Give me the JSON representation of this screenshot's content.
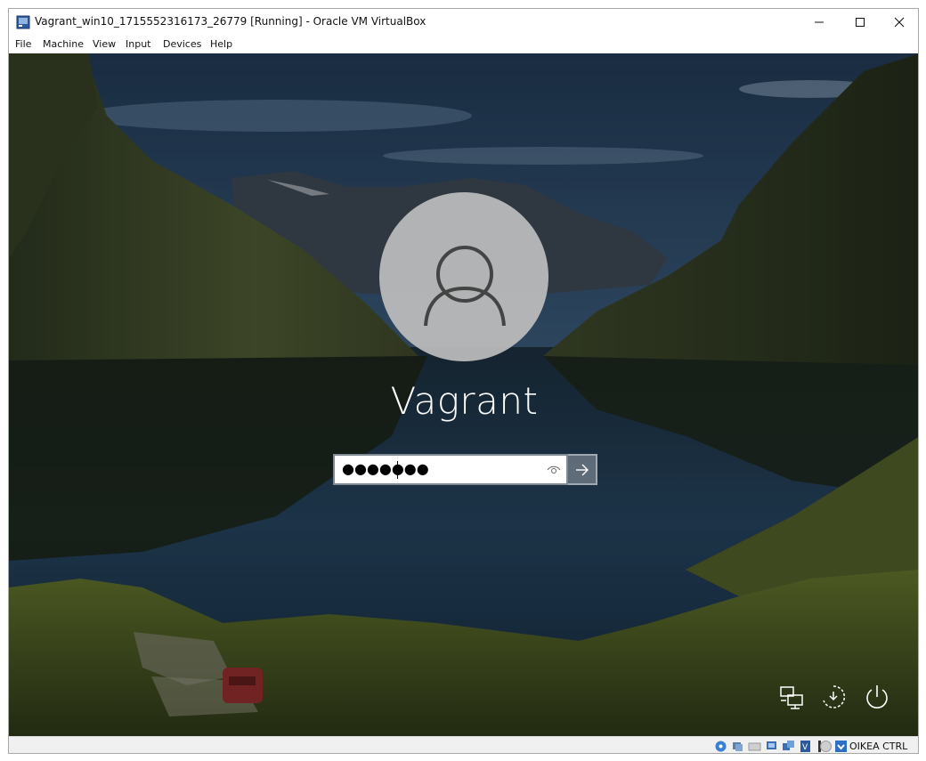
{
  "window": {
    "title": "Vagrant_win10_1715552316173_26779 [Running] - Oracle VM VirtualBox",
    "controls": {
      "minimize": "minimize-icon",
      "maximize": "maximize-icon",
      "close": "close-icon"
    }
  },
  "menubar": {
    "items": [
      "File",
      "Machine",
      "View",
      "Input",
      "Devices",
      "Help"
    ]
  },
  "lockscreen": {
    "username": "Vagrant",
    "password_masked": "●●●●●●●",
    "icons": {
      "avatar": "user-avatar-icon",
      "reveal": "eye-icon",
      "submit": "arrow-right-icon",
      "network": "network-icon",
      "accessibility": "ease-of-access-icon",
      "power": "power-icon"
    }
  },
  "statusbar": {
    "host_key": "OIKEA CTRL",
    "icons": [
      "hard-disk-icon",
      "optical-drive-icon",
      "audio-icon",
      "network-adapter-icon",
      "usb-icon",
      "shared-folders-icon",
      "display-icon",
      "video-capture-icon",
      "cpu-icon",
      "mouse-integration-icon"
    ]
  },
  "colors": {
    "sky": "#2b4a68",
    "water": "#1d3a56",
    "grass": "#5a6a2a",
    "avatar_bg": "#bebebe"
  }
}
